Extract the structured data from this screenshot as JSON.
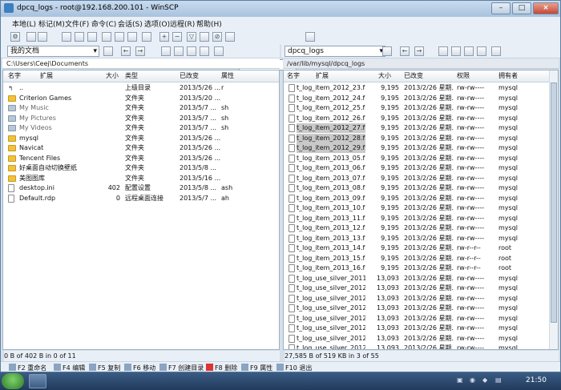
{
  "window": {
    "title": "dpcq_logs - root@192.168.200.101 - WinSCP"
  },
  "menu": [
    "本地(L)",
    "标记(M)",
    "文件(F)",
    "命令(C)",
    "会话(S)",
    "选项(O)",
    "远程(R)",
    "帮助(H)"
  ],
  "toolbar": {
    "transfer_preset": "默认"
  },
  "left": {
    "location": "我的文档",
    "path": "C:\\Users\\Ceej\\Documents",
    "headers": {
      "name": "名字",
      "ext": "扩展",
      "size": "大小",
      "type": "类型",
      "changed": "已改变",
      "attr": "属性"
    },
    "rows": [
      {
        "name": "..",
        "size": "",
        "type": "上级目录",
        "changed": "2013/5/26 ...",
        "attr": "r",
        "icon": "up"
      },
      {
        "name": "Criterion Games",
        "size": "",
        "type": "文件夹",
        "changed": "2013/5/20 ...",
        "attr": "",
        "icon": "folder"
      },
      {
        "name": "My Music",
        "size": "",
        "type": "文件夹",
        "changed": "2013/5/7 ...",
        "attr": "sh",
        "icon": "folder-gray"
      },
      {
        "name": "My Pictures",
        "size": "",
        "type": "文件夹",
        "changed": "2013/5/7 ...",
        "attr": "sh",
        "icon": "folder-gray"
      },
      {
        "name": "My Videos",
        "size": "",
        "type": "文件夹",
        "changed": "2013/5/7 ...",
        "attr": "sh",
        "icon": "folder-gray"
      },
      {
        "name": "mysql",
        "size": "",
        "type": "文件夹",
        "changed": "2013/5/26 ...",
        "attr": "",
        "icon": "folder"
      },
      {
        "name": "Navicat",
        "size": "",
        "type": "文件夹",
        "changed": "2013/5/26 ...",
        "attr": "",
        "icon": "folder"
      },
      {
        "name": "Tencent Files",
        "size": "",
        "type": "文件夹",
        "changed": "2013/5/26 ...",
        "attr": "",
        "icon": "folder"
      },
      {
        "name": "好桌面自动切换壁纸",
        "size": "",
        "type": "文件夹",
        "changed": "2013/5/8 ...",
        "attr": "",
        "icon": "folder"
      },
      {
        "name": "美图图库",
        "size": "",
        "type": "文件夹",
        "changed": "2013/5/16 ...",
        "attr": "",
        "icon": "folder"
      },
      {
        "name": "desktop.ini",
        "size": "402",
        "type": "配置设置",
        "changed": "2013/5/8 ...",
        "attr": "ash",
        "icon": "file"
      },
      {
        "name": "Default.rdp",
        "size": "0",
        "type": "远程桌面连接",
        "changed": "2013/5/7 ...",
        "attr": "ah",
        "icon": "file"
      }
    ],
    "status": "0 B of 402 B in 0 of 11"
  },
  "right": {
    "location": "dpcq_logs",
    "path": "/var/lib/mysql/dpcq_logs",
    "headers": {
      "name": "名字",
      "ext": "扩展",
      "size": "大小",
      "changed": "已改变",
      "rights": "权限",
      "owner": "拥有者"
    },
    "rows": [
      {
        "name": "t_log_item_2012_23.frm",
        "size": "9,195",
        "changed": "2013/2/26 星期...",
        "rights": "rw-rw----",
        "owner": "mysql"
      },
      {
        "name": "t_log_item_2012_24.frm",
        "size": "9,195",
        "changed": "2013/2/26 星期...",
        "rights": "rw-rw----",
        "owner": "mysql"
      },
      {
        "name": "t_log_item_2012_25.frm",
        "size": "9,195",
        "changed": "2013/2/26 星期...",
        "rights": "rw-rw----",
        "owner": "mysql"
      },
      {
        "name": "t_log_item_2012_26.frm",
        "size": "9,195",
        "changed": "2013/2/26 星期...",
        "rights": "rw-rw----",
        "owner": "mysql"
      },
      {
        "name": "t_log_item_2012_27.frm",
        "size": "9,195",
        "changed": "2013/2/26 星期...",
        "rights": "rw-rw----",
        "owner": "mysql",
        "selected": true
      },
      {
        "name": "t_log_item_2012_28.frm",
        "size": "9,195",
        "changed": "2013/2/26 星期...",
        "rights": "rw-rw----",
        "owner": "mysql",
        "selected": true
      },
      {
        "name": "t_log_item_2012_29.frm",
        "size": "9,195",
        "changed": "2013/2/26 星期...",
        "rights": "rw-rw----",
        "owner": "mysql",
        "selected": true
      },
      {
        "name": "t_log_item_2013_05.frm",
        "size": "9,195",
        "changed": "2013/2/26 星期...",
        "rights": "rw-rw----",
        "owner": "mysql"
      },
      {
        "name": "t_log_item_2013_06.frm",
        "size": "9,195",
        "changed": "2013/2/26 星期...",
        "rights": "rw-rw----",
        "owner": "mysql"
      },
      {
        "name": "t_log_item_2013_07.frm",
        "size": "9,195",
        "changed": "2013/2/26 星期...",
        "rights": "rw-rw----",
        "owner": "mysql"
      },
      {
        "name": "t_log_item_2013_08.frm",
        "size": "9,195",
        "changed": "2013/2/26 星期...",
        "rights": "rw-rw----",
        "owner": "mysql"
      },
      {
        "name": "t_log_item_2013_09.frm",
        "size": "9,195",
        "changed": "2013/2/26 星期...",
        "rights": "rw-rw----",
        "owner": "mysql"
      },
      {
        "name": "t_log_item_2013_10.frm",
        "size": "9,195",
        "changed": "2013/2/26 星期...",
        "rights": "rw-rw----",
        "owner": "mysql"
      },
      {
        "name": "t_log_item_2013_11.frm",
        "size": "9,195",
        "changed": "2013/2/26 星期...",
        "rights": "rw-rw----",
        "owner": "mysql"
      },
      {
        "name": "t_log_item_2013_12.frm",
        "size": "9,195",
        "changed": "2013/2/26 星期...",
        "rights": "rw-rw----",
        "owner": "mysql"
      },
      {
        "name": "t_log_item_2013_13.frm",
        "size": "9,195",
        "changed": "2013/2/26 星期...",
        "rights": "rw-rw----",
        "owner": "mysql"
      },
      {
        "name": "t_log_item_2013_14.frm",
        "size": "9,195",
        "changed": "2013/2/26 星期...",
        "rights": "rw-r--r--",
        "owner": "root"
      },
      {
        "name": "t_log_item_2013_15.frm",
        "size": "9,195",
        "changed": "2013/2/26 星期...",
        "rights": "rw-r--r--",
        "owner": "root"
      },
      {
        "name": "t_log_item_2013_16.frm",
        "size": "9,195",
        "changed": "2013/2/26 星期...",
        "rights": "rw-r--r--",
        "owner": "root"
      },
      {
        "name": "t_log_use_silver_2011_...",
        "size": "13,093",
        "changed": "2013/2/26 星期...",
        "rights": "rw-rw----",
        "owner": "mysql"
      },
      {
        "name": "t_log_use_silver_2012_...",
        "size": "13,093",
        "changed": "2013/2/26 星期...",
        "rights": "rw-rw----",
        "owner": "mysql"
      },
      {
        "name": "t_log_use_silver_2012_...",
        "size": "13,093",
        "changed": "2013/2/26 星期...",
        "rights": "rw-rw----",
        "owner": "mysql"
      },
      {
        "name": "t_log_use_silver_2012_...",
        "size": "13,093",
        "changed": "2013/2/26 星期...",
        "rights": "rw-rw----",
        "owner": "mysql"
      },
      {
        "name": "t_log_use_silver_2012_...",
        "size": "13,093",
        "changed": "2013/2/26 星期...",
        "rights": "rw-rw----",
        "owner": "mysql"
      },
      {
        "name": "t_log_use_silver_2012_...",
        "size": "13,093",
        "changed": "2013/2/26 星期...",
        "rights": "rw-rw----",
        "owner": "mysql"
      },
      {
        "name": "t_log_use_silver_2012_...",
        "size": "13,093",
        "changed": "2013/2/26 星期...",
        "rights": "rw-rw----",
        "owner": "mysql"
      },
      {
        "name": "t_log_use_silver_2012_...",
        "size": "13,093",
        "changed": "2013/2/26 星期...",
        "rights": "rw-rw----",
        "owner": "mysql"
      }
    ],
    "status": "27,585 B of 519 KB in 3 of 55"
  },
  "fkeys": [
    "F2 重命名",
    "F4 编辑",
    "F5 复制",
    "F6 移动",
    "F7 创建目录",
    "F8 删除",
    "F9 属性",
    "F10 退出"
  ],
  "taskbar": {
    "clock": "21:50"
  }
}
